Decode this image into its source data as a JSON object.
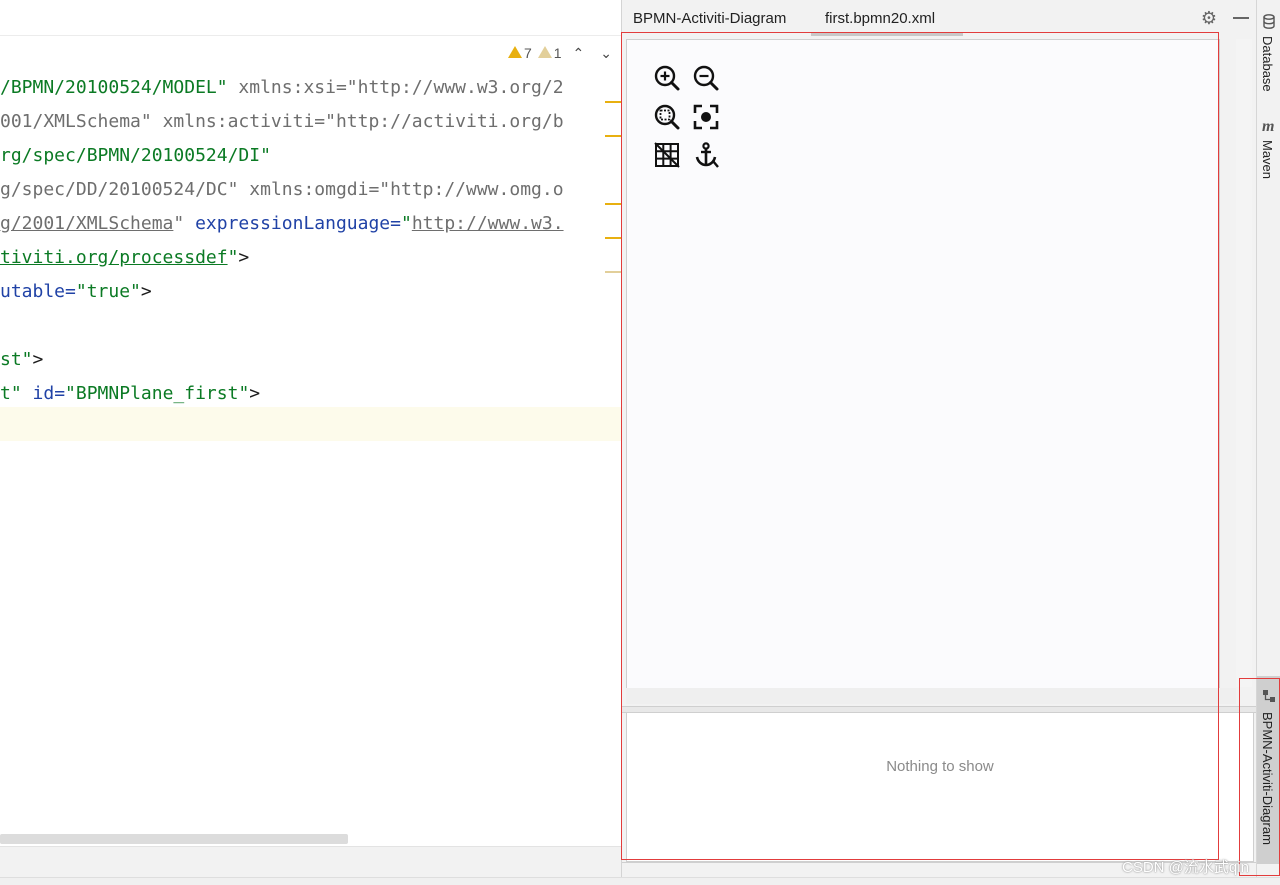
{
  "editor": {
    "inspections": {
      "warnings": "7",
      "weak_warnings": "1"
    },
    "lines": [
      [
        [
          "s",
          "/BPMN/20100524/MODEL\""
        ],
        [
          "k",
          " "
        ],
        [
          "g",
          "xmlns:xsi=\"http://www.w3.org/2"
        ]
      ],
      [
        [
          "g",
          "001/XMLSchema\""
        ],
        [
          "k",
          " "
        ],
        [
          "g",
          "xmlns:activiti=\"http://activiti.org/b"
        ]
      ],
      [
        [
          "s",
          "rg/spec/BPMN/20100524/DI\""
        ]
      ],
      [
        [
          "g",
          "g/spec/DD/20100524/DC\""
        ],
        [
          "k",
          " "
        ],
        [
          "g",
          "xmlns:omgdi=\"http://www.omg.o"
        ]
      ],
      [
        [
          "gu",
          "g/2001/XMLSchema"
        ],
        [
          "g",
          "\""
        ],
        [
          "k",
          " "
        ],
        [
          "a",
          "expressionLanguage="
        ],
        [
          "s",
          "\""
        ],
        [
          "gu",
          "http://www.w3."
        ]
      ],
      [
        [
          "su",
          "tiviti.org/processdef"
        ],
        [
          "s",
          "\""
        ],
        [
          "k",
          ">"
        ]
      ],
      [
        [
          "a",
          "utable="
        ],
        [
          "s",
          "\"true\""
        ],
        [
          "k",
          ">"
        ]
      ],
      [],
      [
        [
          "s",
          "st\""
        ],
        [
          "k",
          ">"
        ]
      ],
      [
        [
          "s",
          "t\""
        ],
        [
          "k",
          " "
        ],
        [
          "a",
          "id="
        ],
        [
          "s",
          "\"BPMNPlane_first\""
        ],
        [
          "k",
          ">"
        ]
      ],
      []
    ]
  },
  "toolwindow": {
    "title": "BPMN-Activiti-Diagram",
    "tab_label": "first.bpmn20.xml",
    "tools": [
      "zoom-in-icon",
      "zoom-out-icon",
      "zoom-actual-icon",
      "zoom-fit-icon",
      "grid-toggle-icon",
      "anchor-icon"
    ],
    "properties_empty": "Nothing to show"
  },
  "stripe": {
    "database_label": "Database",
    "maven_label": "Maven",
    "bpmn_label": "BPMN-Activiti-Diagram"
  },
  "watermark": "CSDN @流水武qin",
  "colors": {
    "string": "#0b7a24",
    "attribute": "#2042a6",
    "namespace": "#6e6e6e",
    "warning": "#e8b010",
    "highlight": "#e23c3c"
  }
}
